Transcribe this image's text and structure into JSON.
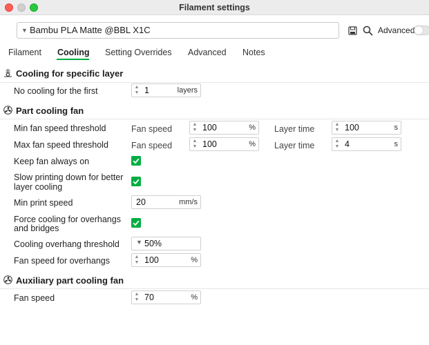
{
  "window": {
    "title": "Filament settings"
  },
  "header": {
    "preset": "Bambu PLA Matte @BBL X1C",
    "advanced_label": "Advanced",
    "advanced_on": false
  },
  "tabs": [
    {
      "label": "Filament"
    },
    {
      "label": "Cooling",
      "active": true
    },
    {
      "label": "Setting Overrides"
    },
    {
      "label": "Advanced"
    },
    {
      "label": "Notes"
    }
  ],
  "sections": {
    "specific_layer": {
      "title": "Cooling for specific layer",
      "no_cooling_label": "No cooling for the first",
      "no_cooling_value": "1",
      "no_cooling_unit": "layers"
    },
    "part_fan": {
      "title": "Part cooling fan",
      "min_fan_label": "Min fan speed threshold",
      "max_fan_label": "Max fan speed threshold",
      "fan_speed_sub": "Fan speed",
      "layer_time_sub": "Layer time",
      "min_fan_speed": "100",
      "min_layer_time": "100",
      "max_fan_speed": "100",
      "max_layer_time": "4",
      "percent_unit": "%",
      "seconds_unit": "s",
      "keep_fan_label": "Keep fan always on",
      "slow_down_label_1": "Slow printing down for better",
      "slow_down_label_2": "layer cooling",
      "min_print_speed_label": "Min print speed",
      "min_print_speed": "20",
      "min_print_speed_unit": "mm/s",
      "force_cooling_label_1": "Force cooling for overhangs",
      "force_cooling_label_2": "and bridges",
      "overhang_threshold_label": "Cooling overhang threshold",
      "overhang_threshold": "50%",
      "overhang_fan_label": "Fan speed for overhangs",
      "overhang_fan": "100",
      "overhang_fan_unit": "%"
    },
    "aux_fan": {
      "title": "Auxiliary part cooling fan",
      "fan_speed_label": "Fan speed",
      "fan_speed": "70",
      "fan_speed_unit": "%"
    }
  },
  "colors": {
    "accent": "#00ae42"
  }
}
